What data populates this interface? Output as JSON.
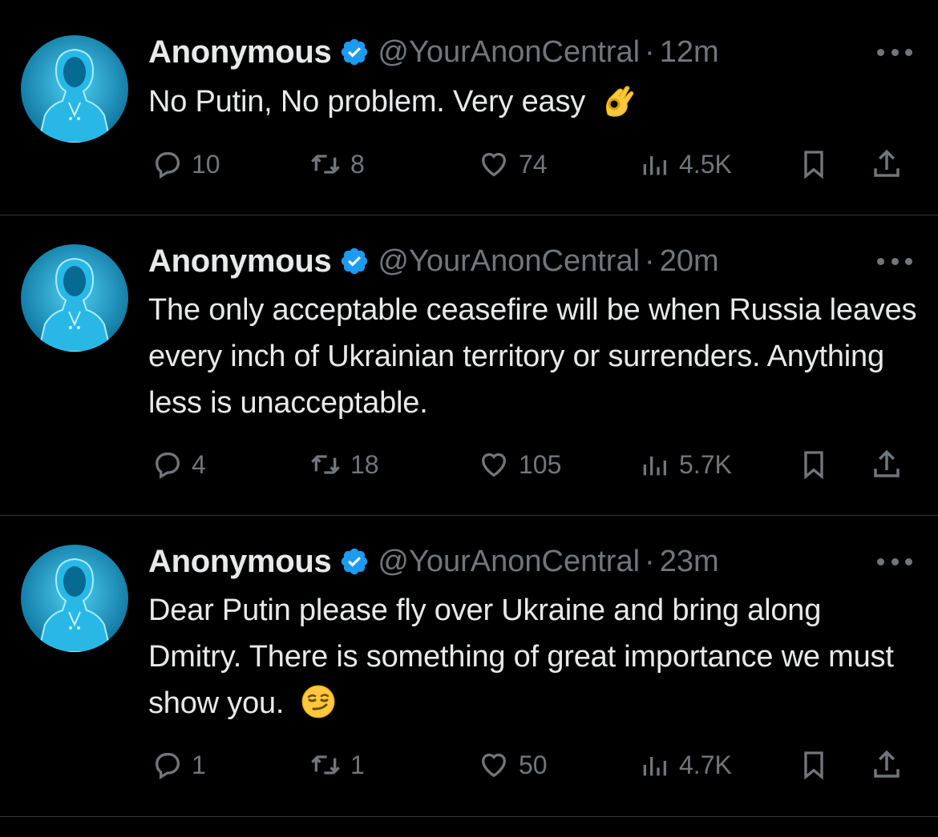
{
  "colors": {
    "background": "#000000",
    "text_primary": "#e7e9ea",
    "text_secondary": "#71767b",
    "verified_badge": "#1d9bf0",
    "divider": "#2f3336",
    "avatar_glow": "#1a9fd6"
  },
  "tweets": [
    {
      "author": {
        "name": "Anonymous",
        "verified": true,
        "handle": "@YourAnonCentral",
        "avatar": "hooded-figure-avatar"
      },
      "separator": "·",
      "time": "12m",
      "text": "No Putin, No problem. Very easy",
      "emoji": "ok-hand-emoji",
      "stats": {
        "replies": "10",
        "reposts": "8",
        "likes": "74",
        "views": "4.5K"
      }
    },
    {
      "author": {
        "name": "Anonymous",
        "verified": true,
        "handle": "@YourAnonCentral",
        "avatar": "hooded-figure-avatar"
      },
      "separator": "·",
      "time": "20m",
      "text": "The only acceptable ceasefire will be when Russia leaves every inch of Ukrainian territory or surrenders. Anything less is unacceptable.",
      "emoji": "",
      "stats": {
        "replies": "4",
        "reposts": "18",
        "likes": "105",
        "views": "5.7K"
      }
    },
    {
      "author": {
        "name": "Anonymous",
        "verified": true,
        "handle": "@YourAnonCentral",
        "avatar": "hooded-figure-avatar"
      },
      "separator": "·",
      "time": "23m",
      "text": "Dear Putin please fly over Ukraine and bring along Dmitry. There is something of great importance we must show you.",
      "emoji": "smirking-face-emoji",
      "stats": {
        "replies": "1",
        "reposts": "1",
        "likes": "50",
        "views": "4.7K"
      }
    }
  ]
}
